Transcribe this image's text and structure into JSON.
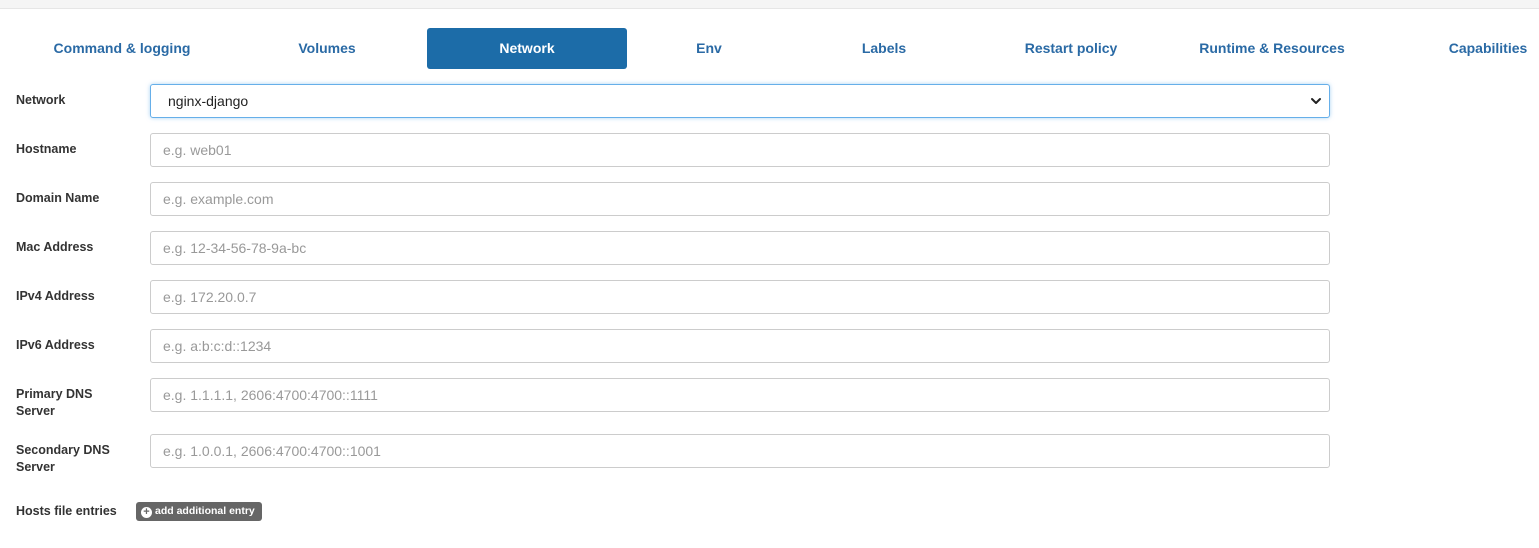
{
  "tabs": [
    {
      "label": "Command & logging"
    },
    {
      "label": "Volumes"
    },
    {
      "label": "Network"
    },
    {
      "label": "Env"
    },
    {
      "label": "Labels"
    },
    {
      "label": "Restart policy"
    },
    {
      "label": "Runtime & Resources"
    },
    {
      "label": "Capabilities"
    }
  ],
  "active_tab": "Network",
  "form": {
    "network": {
      "label": "Network",
      "value": "nginx-django",
      "icon": "chevron-down-icon"
    },
    "hostname": {
      "label": "Hostname",
      "placeholder": "e.g. web01"
    },
    "domain_name": {
      "label": "Domain Name",
      "placeholder": "e.g. example.com"
    },
    "mac_address": {
      "label": "Mac Address",
      "placeholder": "e.g. 12-34-56-78-9a-bc"
    },
    "ipv4_address": {
      "label": "IPv4 Address",
      "placeholder": "e.g. 172.20.0.7"
    },
    "ipv6_address": {
      "label": "IPv6 Address",
      "placeholder": "e.g. a:b:c:d::1234"
    },
    "primary_dns": {
      "label_line1": "Primary DNS",
      "label_line2": "Server",
      "placeholder": "e.g. 1.1.1.1, 2606:4700:4700::1111"
    },
    "secondary_dns": {
      "label_line1": "Secondary DNS",
      "label_line2": "Server",
      "placeholder": "e.g. 1.0.0.1, 2606:4700:4700::1001"
    },
    "hosts_file": {
      "label": "Hosts file entries",
      "button_label": "add additional entry",
      "button_icon": "plus-circle-icon"
    }
  },
  "colors": {
    "accent": "#1c6ca8",
    "tab_text": "#2a6aa5",
    "focus_border": "#66afe9",
    "button_bg": "#666666"
  }
}
